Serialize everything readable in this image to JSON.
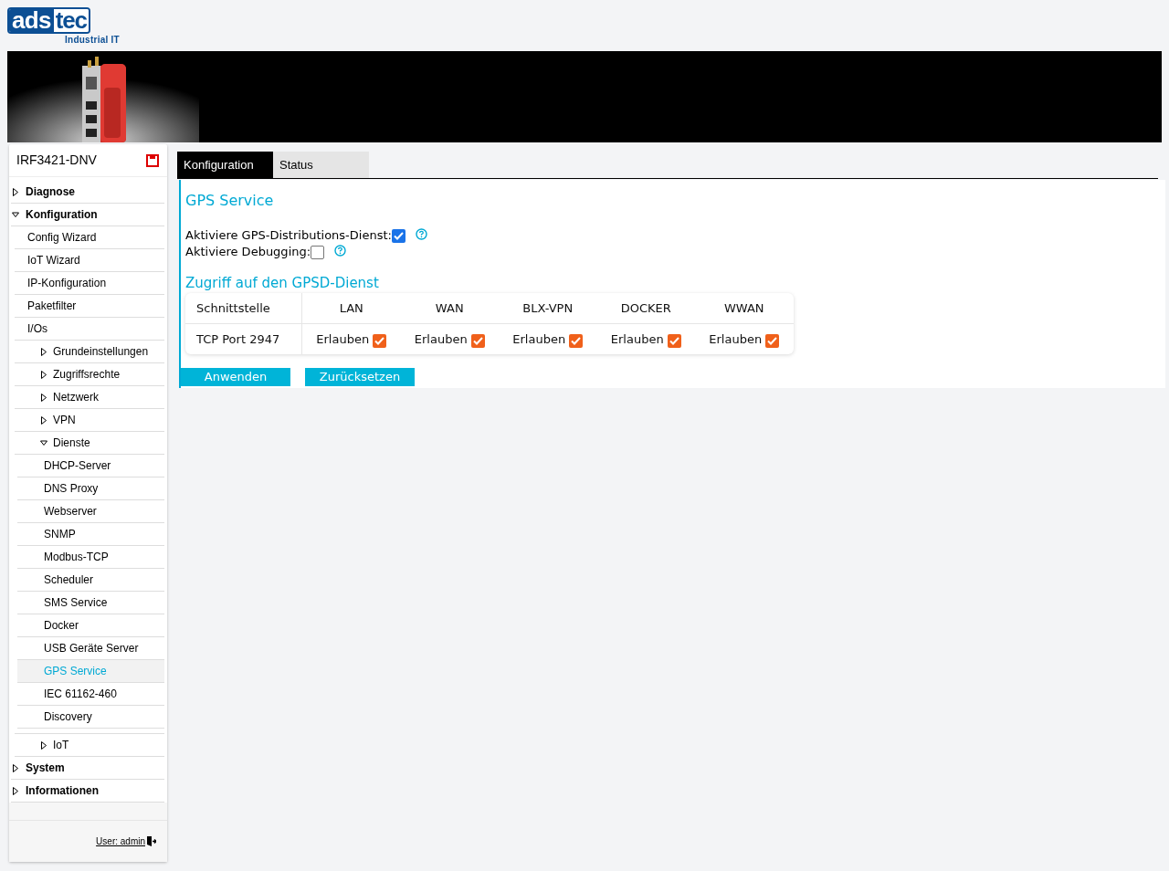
{
  "logo": {
    "brand_left": "ads",
    "brand_right": "tec",
    "tagline": "Industrial IT"
  },
  "sidebar": {
    "device": "IRF3421-DNV",
    "items": [
      {
        "label": "Diagnose",
        "expanded": false,
        "selected": false
      },
      {
        "label": "Konfiguration",
        "expanded": true,
        "selected": false,
        "children": [
          {
            "label": "Config Wizard",
            "selected": false
          },
          {
            "label": "IoT Wizard",
            "selected": false
          },
          {
            "label": "IP-Konfiguration",
            "selected": false
          },
          {
            "label": "Paketfilter",
            "selected": false
          },
          {
            "label": "I/Os",
            "selected": false,
            "children": [
              {
                "label": "Grundeinstellungen",
                "expanded": false,
                "selected": false
              },
              {
                "label": "Zugriffsrechte",
                "expanded": false,
                "selected": false
              },
              {
                "label": "Netzwerk",
                "expanded": false,
                "selected": false
              },
              {
                "label": "VPN",
                "expanded": false,
                "selected": false
              },
              {
                "label": "Dienste",
                "expanded": true,
                "selected": false,
                "children": [
                  {
                    "label": "DHCP-Server",
                    "selected": false
                  },
                  {
                    "label": "DNS Proxy",
                    "selected": false
                  },
                  {
                    "label": "Webserver",
                    "selected": false
                  },
                  {
                    "label": "SNMP",
                    "selected": false
                  },
                  {
                    "label": "Modbus-TCP",
                    "selected": false
                  },
                  {
                    "label": "Scheduler",
                    "selected": false
                  },
                  {
                    "label": "SMS Service",
                    "selected": false
                  },
                  {
                    "label": "Docker",
                    "selected": false
                  },
                  {
                    "label": "USB Geräte Server",
                    "selected": false
                  },
                  {
                    "label": "GPS Service",
                    "selected": true
                  },
                  {
                    "label": "IEC 61162-460",
                    "selected": false
                  },
                  {
                    "label": "Discovery",
                    "selected": false
                  }
                ]
              },
              {
                "label": "IoT",
                "expanded": false,
                "selected": false
              }
            ]
          }
        ]
      },
      {
        "label": "System",
        "expanded": false,
        "selected": false
      },
      {
        "label": "Informationen",
        "expanded": false,
        "selected": false
      }
    ],
    "user": "User: admin"
  },
  "tabs": [
    {
      "label": "Konfiguration",
      "selected": true
    },
    {
      "label": "Status",
      "selected": false
    }
  ],
  "title": "GPS Service",
  "options": [
    {
      "label": "Aktiviere GPS-Distributions-Dienst:",
      "checked": true
    },
    {
      "label": "Aktiviere Debugging:",
      "checked": false
    }
  ],
  "access": {
    "title": "Zugriff auf den GPSD-Dienst",
    "columns": [
      "Schnittstelle",
      "LAN",
      "WAN",
      "BLX-VPN",
      "DOCKER",
      "WWAN"
    ],
    "rows": [
      {
        "cells": [
          {
            "label": "TCP Port 2947"
          },
          {
            "label": "Erlauben",
            "checked": true
          },
          {
            "label": "Erlauben",
            "checked": true
          },
          {
            "label": "Erlauben",
            "checked": true
          },
          {
            "label": "Erlauben",
            "checked": true
          },
          {
            "label": "Erlauben",
            "checked": true
          }
        ]
      }
    ]
  },
  "buttons": [
    "Anwenden",
    "Zurücksetzen"
  ]
}
